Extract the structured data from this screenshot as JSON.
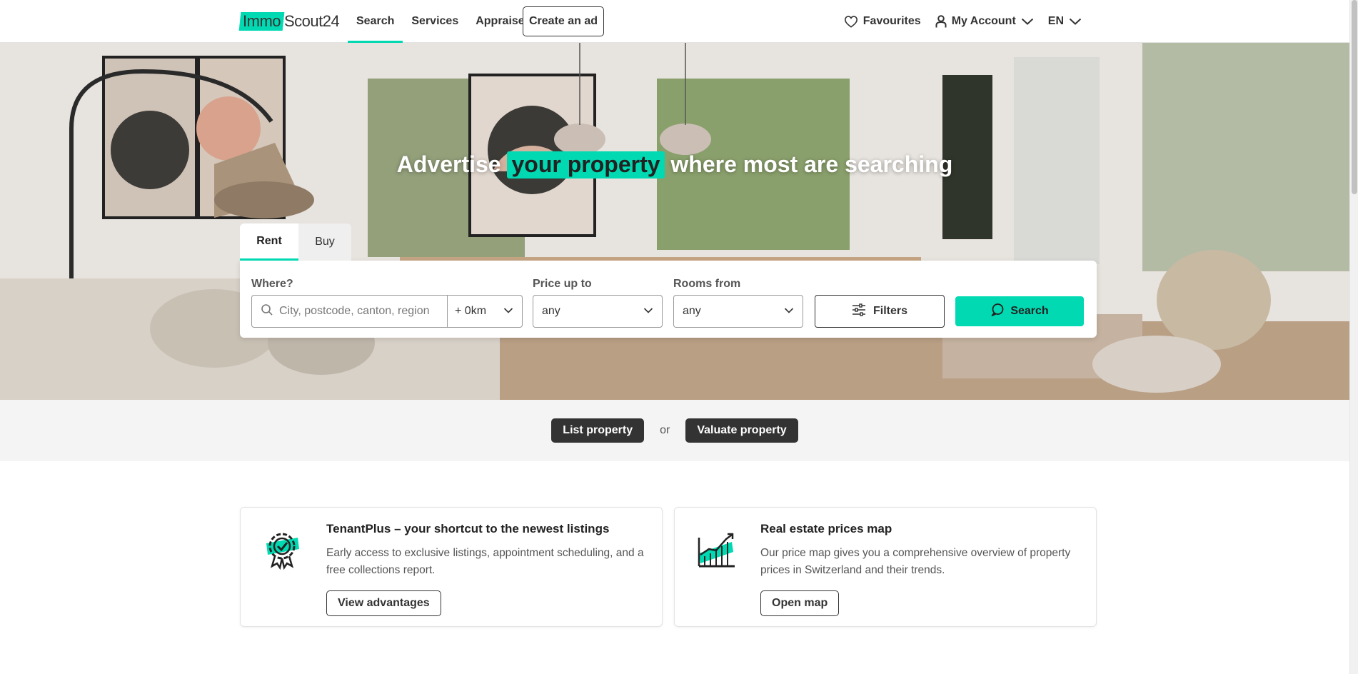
{
  "header": {
    "logo_part1": "Immo",
    "logo_part2": "Scout24",
    "nav": [
      {
        "label": "Search"
      },
      {
        "label": "Services"
      },
      {
        "label": "Appraise"
      }
    ],
    "create_ad": "Create an ad",
    "favourites": "Favourites",
    "my_account": "My Account",
    "language": "EN"
  },
  "hero": {
    "title_pre": "Advertise",
    "title_highlight": "your property",
    "title_post": "where most are searching"
  },
  "search": {
    "tabs": [
      {
        "label": "Rent"
      },
      {
        "label": "Buy"
      }
    ],
    "where_label": "Where?",
    "where_placeholder": "City, postcode, canton, region",
    "radius_value": "+ 0km",
    "price_label": "Price up to",
    "price_value": "any",
    "rooms_label": "Rooms from",
    "rooms_value": "any",
    "filters_label": "Filters",
    "search_label": "Search"
  },
  "cta": {
    "list_property": "List property",
    "or": "or",
    "valuate_property": "Valuate property"
  },
  "cards": [
    {
      "title": "TenantPlus – your shortcut to the newest listings",
      "text": "Early access to exclusive listings, appointment scheduling, and a free collections report.",
      "button": "View advantages",
      "icon": "badge-check-icon"
    },
    {
      "title": "Real estate prices map",
      "text": "Our price map gives you a comprehensive overview of property prices in Switzerland and their trends.",
      "button": "Open map",
      "icon": "price-chart-icon"
    }
  ],
  "colors": {
    "accent": "#00d9b1",
    "dark": "#333333"
  }
}
